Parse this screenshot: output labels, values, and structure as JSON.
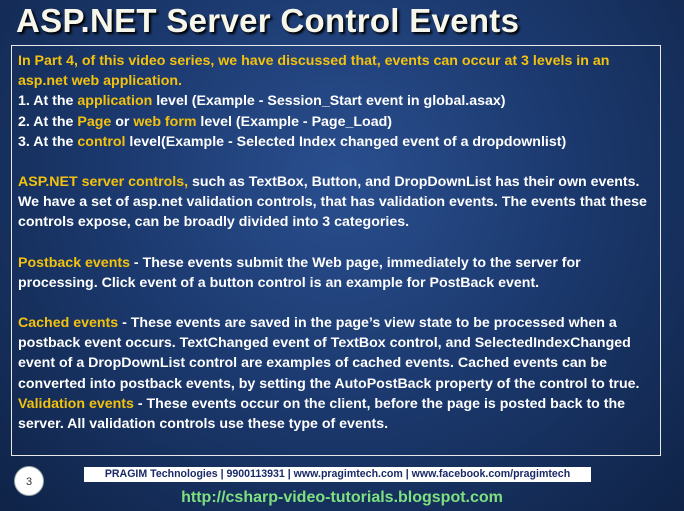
{
  "slide": {
    "title": "ASP.NET Server Control Events",
    "page_number": "3"
  },
  "content": {
    "intro": "In Part 4, of this video series, we have discussed that, events can occur at 3 levels in an asp.net web application.",
    "level1_prefix": "1. At the ",
    "level1_hl": "application",
    "level1_rest": " level (Example - Session_Start event in global.asax)",
    "level2_prefix": "2. At the ",
    "level2_hl1": "Page",
    "level2_mid": " or ",
    "level2_hl2": "web form",
    "level2_rest": " level (Example - Page_Load)",
    "level3_prefix": "3. At the ",
    "level3_hl": "control",
    "level3_rest": " level(Example - Selected Index changed event of a dropdownlist)",
    "server_controls_hl": "ASP.NET server controls,",
    "server_controls_rest": " such as TextBox, Button, and DropDownList has their own events. We have a set of asp.net validation controls, that has validation events. The events that these controls expose, can be broadly divided into 3 categories.",
    "postback_hl": "Postback events",
    "postback_rest": " - These events submit the Web page, immediately to the server for processing. Click event of a button control is an example for PostBack event.",
    "cached_hl": "Cached events",
    "cached_rest": " - These events are saved in the page’s view state to be processed when a postback event occurs. TextChanged event of TextBox control, and SelectedIndexChanged event of a DropDownList control are examples of cached events. Cached events can be converted into postback events, by setting the AutoPostBack property of the control to true.",
    "validation_hl": "Validation events",
    "validation_rest": " - These events occur on the client, before the page is posted back to the server. All validation controls use these type of events."
  },
  "footer": {
    "text": "PRAGIM Technologies | 9900113931 | www.pragimtech.com | www.facebook.com/pragimtech",
    "link": "http://csharp-video-tutorials.blogspot.com"
  },
  "colors": {
    "highlight": "#f4c20d",
    "background": "#1c3a70",
    "link": "#7fe07f"
  }
}
